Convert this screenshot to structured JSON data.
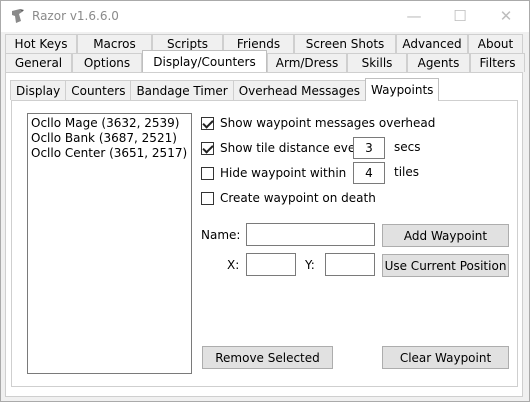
{
  "window": {
    "title": "Razor v1.6.6.0"
  },
  "tabs_row1": [
    "Hot Keys",
    "Macros",
    "Scripts",
    "Friends",
    "Screen Shots",
    "Advanced",
    "About"
  ],
  "tabs_row2": [
    "General",
    "Options",
    "Display/Counters",
    "Arm/Dress",
    "Skills",
    "Agents",
    "Filters"
  ],
  "active_tab": "Display/Counters",
  "subtabs": [
    "Display",
    "Counters",
    "Bandage Timer",
    "Overhead Messages",
    "Waypoints"
  ],
  "active_subtab": "Waypoints",
  "waypoints": [
    "Ocllo Mage (3632, 2539)",
    "Ocllo Bank (3687, 2521)",
    "Ocllo Center (3651, 2517)"
  ],
  "options": {
    "show_messages": {
      "label": "Show waypoint messages overhead",
      "checked": true
    },
    "show_distance": {
      "label": "Show tile distance every",
      "checked": true,
      "value": "3",
      "unit": "secs"
    },
    "hide_within": {
      "label": "Hide waypoint within",
      "checked": false,
      "value": "4",
      "unit": "tiles"
    },
    "create_on_death": {
      "label": "Create waypoint on death",
      "checked": false
    }
  },
  "form": {
    "name_label": "Name:",
    "name_value": "",
    "x_label": "X:",
    "x_value": "",
    "y_label": "Y:",
    "y_value": ""
  },
  "buttons": {
    "add_waypoint": "Add Waypoint",
    "use_current_position": "Use Current Position",
    "remove_selected": "Remove Selected",
    "clear_waypoint": "Clear Waypoint"
  }
}
